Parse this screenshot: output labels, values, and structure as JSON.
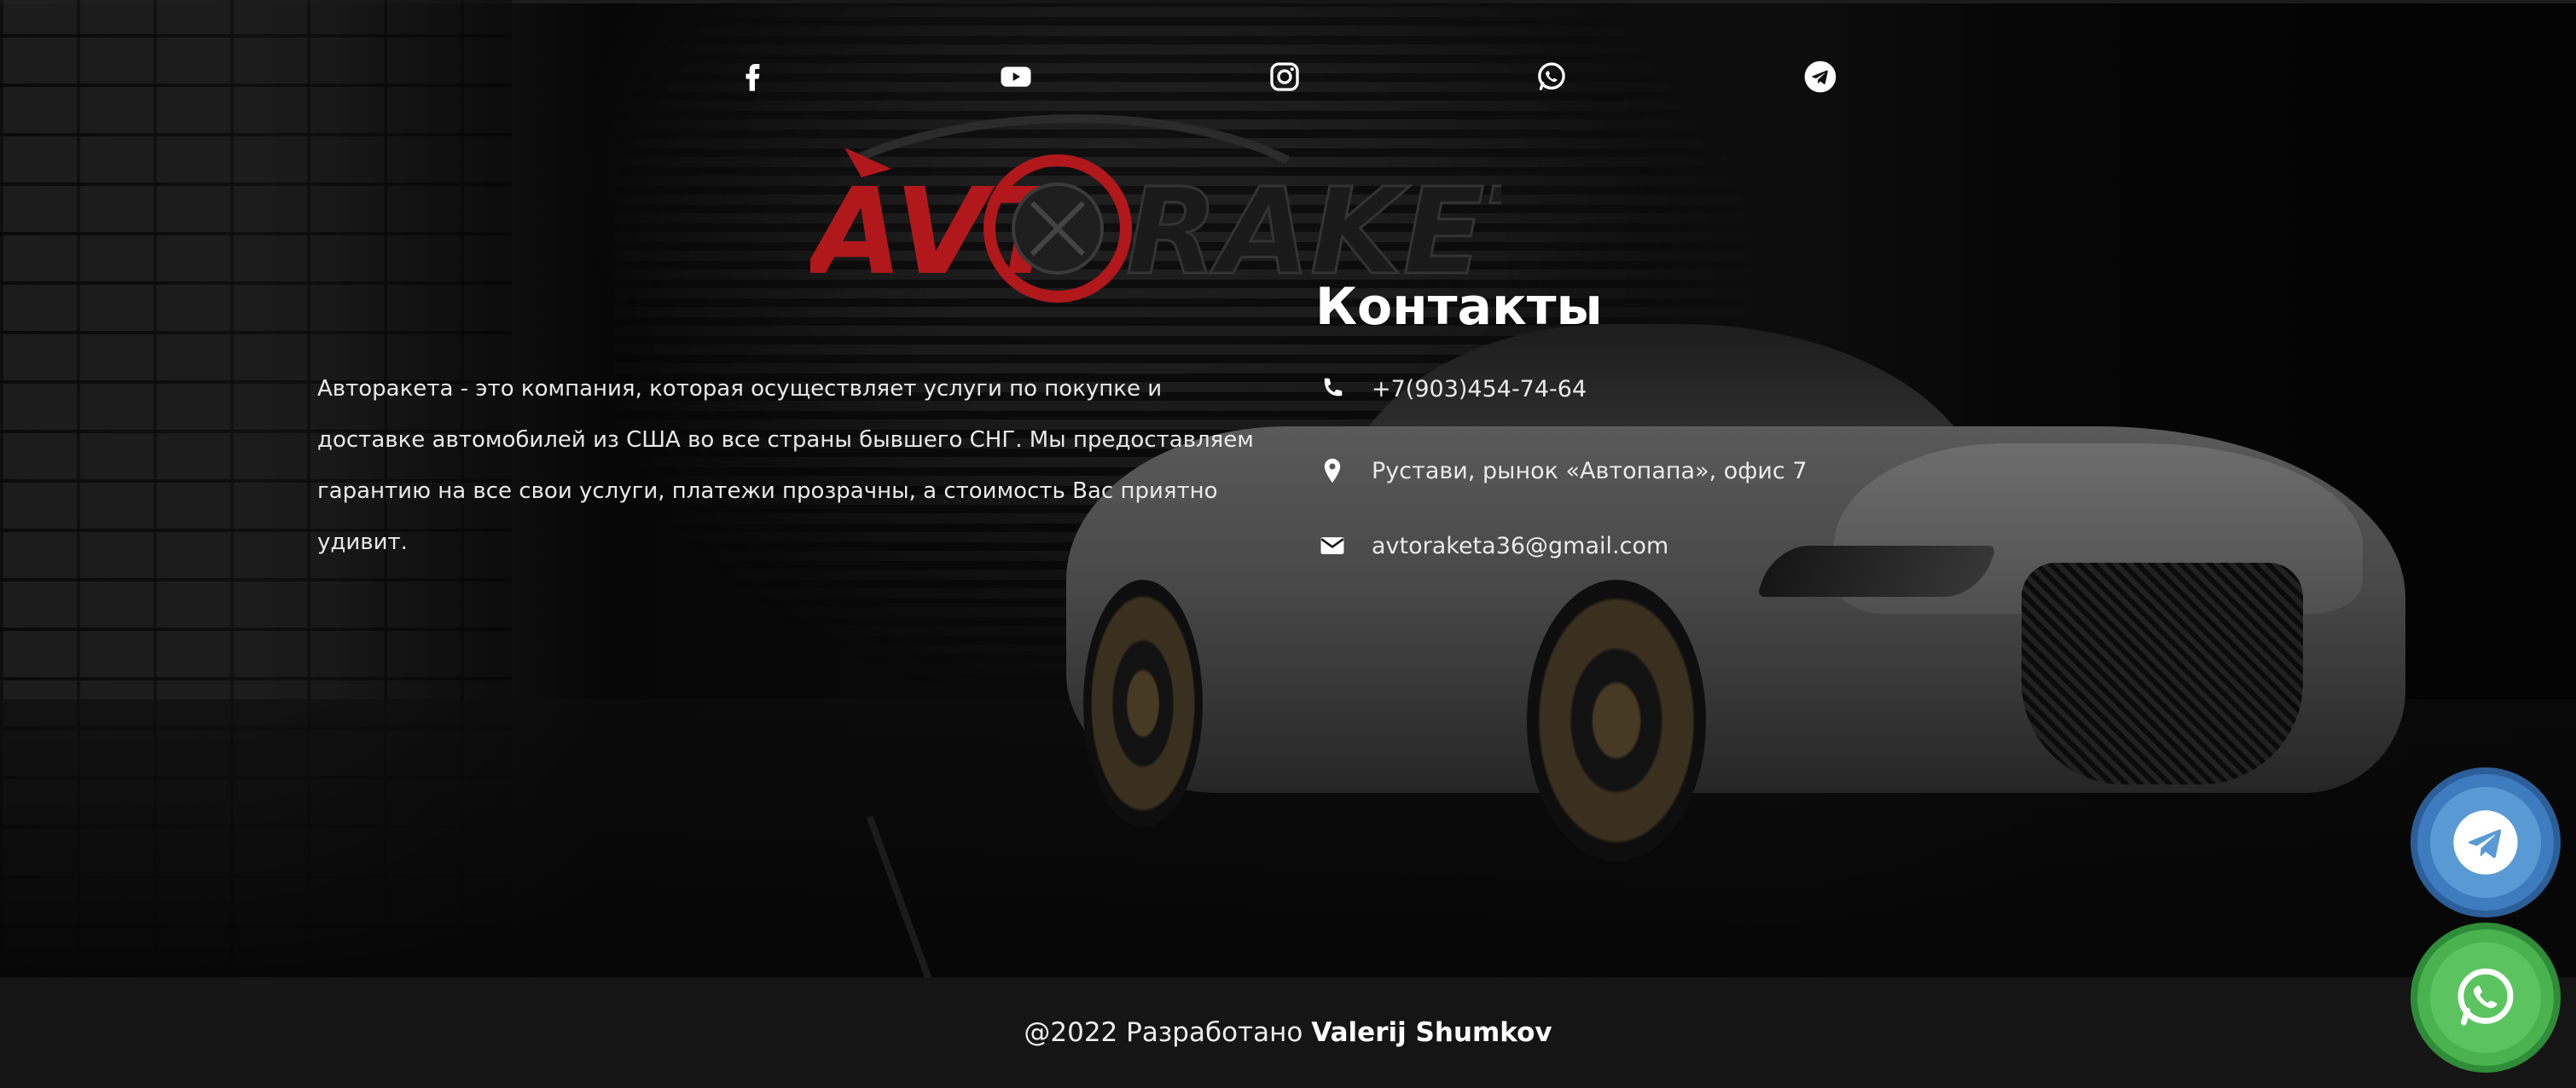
{
  "social": {
    "items": [
      {
        "name": "facebook-icon"
      },
      {
        "name": "youtube-icon"
      },
      {
        "name": "instagram-icon"
      },
      {
        "name": "whatsapp-icon"
      },
      {
        "name": "telegram-icon"
      }
    ]
  },
  "logo": {
    "text_left": "AVT",
    "text_right": "RAKETA",
    "accent_color": "#b0181c"
  },
  "about": {
    "text": "Авторакета - это компания, которая осуществляет услуги по покупке и доставке автомобилей из США во все страны бывшего СНГ. Мы предоставляем гарантию на все свои услуги, платежи прозрачны, а стоимость Вас приятно удивит."
  },
  "contacts": {
    "title": "Контакты",
    "phone": "+7(903)454-74-64",
    "address": "Рустави, рынок «Автопапа», офис 7",
    "email": "avtoraketa36@gmail.com"
  },
  "footer": {
    "prefix": "@2022 Разработано",
    "author": "Valerij Shumkov"
  },
  "floating": {
    "telegram_color": "#3e7cbf",
    "whatsapp_color": "#4ab24f"
  }
}
